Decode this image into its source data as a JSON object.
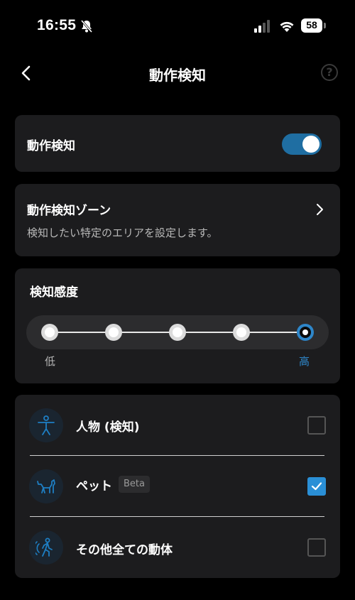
{
  "status_bar": {
    "time": "16:55",
    "battery": "58"
  },
  "header": {
    "title": "動作検知",
    "help_label": "?"
  },
  "motion_detection": {
    "label": "動作検知",
    "enabled": true
  },
  "detection_zone": {
    "label": "動作検知ゾーン",
    "description": "検知したい特定のエリアを設定します。"
  },
  "sensitivity": {
    "label": "検知感度",
    "low_label": "低",
    "high_label": "高",
    "levels": 5,
    "selected_level": 5
  },
  "detection_targets": [
    {
      "label": "人物 (検知)",
      "icon": "person-icon",
      "checked": false
    },
    {
      "label": "ペット",
      "badge": "Beta",
      "icon": "pet-icon",
      "checked": true
    },
    {
      "label": "その他全ての動体",
      "icon": "motion-icon",
      "checked": false
    }
  ],
  "colors": {
    "accent": "#2a8fd6",
    "toggle_on": "#1f6ea2",
    "card_bg": "#1c1c1e",
    "background": "#000000"
  }
}
